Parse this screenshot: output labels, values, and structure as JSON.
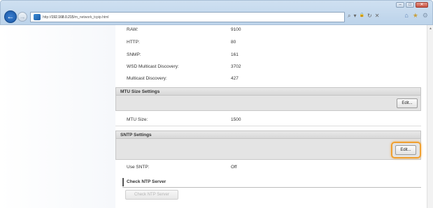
{
  "browser": {
    "url_prefix": "http://",
    "url_host": "192.168.0.215",
    "url_path": "/m_network_tcpip.html",
    "search_icon": "⌕",
    "dropdown_icon": "▾",
    "lock_icon": "🔒",
    "refresh_icon": "↻",
    "stop_icon": "✕",
    "home_icon": "⌂",
    "favorites_icon": "★",
    "tools_icon": "⚙",
    "back_icon": "←",
    "forward_icon": "→",
    "minimize_icon": "–",
    "maximize_icon": "□",
    "close_icon": "✕"
  },
  "port_rows": [
    {
      "label": "RAW:",
      "value": "9100"
    },
    {
      "label": "HTTP:",
      "value": "80"
    },
    {
      "label": "SNMP:",
      "value": "161"
    },
    {
      "label": "WSD Multicast Discovery:",
      "value": "3702"
    },
    {
      "label": "Multicast Discovery:",
      "value": "427"
    }
  ],
  "mtu": {
    "header": "MTU Size Settings",
    "edit_label": "Edit...",
    "row_label": "MTU Size:",
    "row_value": "1500"
  },
  "sntp": {
    "header": "SNTP Settings",
    "edit_label": "Edit...",
    "row_label": "Use SNTP:",
    "row_value": "Off"
  },
  "ntp_check": {
    "header": "Check NTP Server",
    "button_label": "Check NTP Server"
  },
  "colors": {
    "highlight": "#f0a030",
    "section_header_bg": "#d7d7d7",
    "chrome_bg": "#c4d8ec"
  }
}
